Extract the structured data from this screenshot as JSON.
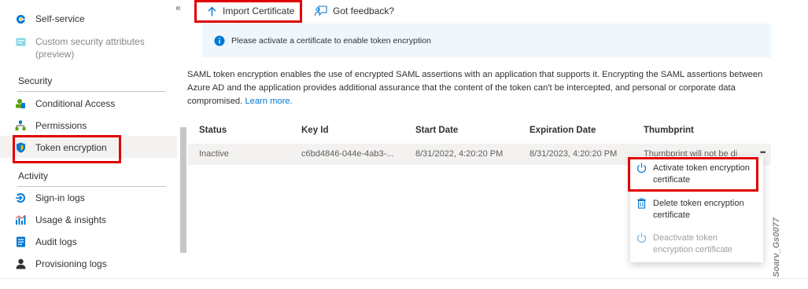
{
  "sidebar": {
    "items_top": [
      {
        "label": "Self-service",
        "icon": "self-service-icon"
      },
      {
        "label": "Custom security attributes\n(preview)",
        "icon": "custom-attributes-icon"
      }
    ],
    "security_heading": "Security",
    "security_items": [
      {
        "label": "Conditional Access",
        "icon": "conditional-access-icon"
      },
      {
        "label": "Permissions",
        "icon": "permissions-icon"
      },
      {
        "label": "Token encryption",
        "icon": "shield-icon",
        "selected": true
      }
    ],
    "activity_heading": "Activity",
    "activity_items": [
      {
        "label": "Sign-in logs",
        "icon": "sign-in-icon"
      },
      {
        "label": "Usage & insights",
        "icon": "chart-icon"
      },
      {
        "label": "Audit logs",
        "icon": "audit-log-icon"
      },
      {
        "label": "Provisioning logs",
        "icon": "user-icon"
      }
    ],
    "collapse_glyph": "«"
  },
  "toolbar": {
    "import_label": "Import Certificate",
    "feedback_label": "Got feedback?"
  },
  "banner": {
    "text": "Please activate a certificate to enable token encryption"
  },
  "description": {
    "text": "SAML token encryption enables the use of encrypted SAML assertions with an application that supports it. Encrypting the SAML assertions between Azure AD and the application provides additional assurance that the content of the token can't be intercepted, and personal or corporate data compromised.",
    "link": "Learn more."
  },
  "table": {
    "headers": [
      "Status",
      "Key Id",
      "Start Date",
      "Expiration Date",
      "Thumbprint"
    ],
    "rows": [
      [
        "Inactive",
        "c6bd4846-044e-4ab3-...",
        "8/31/2022, 4:20:20 PM",
        "8/31/2023, 4:20:20 PM",
        "Thumbprint will not be di"
      ]
    ],
    "more_glyph": "•••"
  },
  "context_menu": {
    "items": [
      {
        "label": "Activate token encryption certificate",
        "icon": "power-icon",
        "enabled": true
      },
      {
        "label": "Delete token encryption certificate",
        "icon": "trash-icon",
        "enabled": true
      },
      {
        "label": "Deactivate token encryption certificate",
        "icon": "power-icon",
        "enabled": false
      }
    ]
  },
  "watermark": "Soarv_Gs0077",
  "colors": {
    "accent": "#0078d4",
    "highlight_red": "#e00000",
    "banner_bg": "#eff6fc",
    "row_bg": "#f3f2f1"
  }
}
